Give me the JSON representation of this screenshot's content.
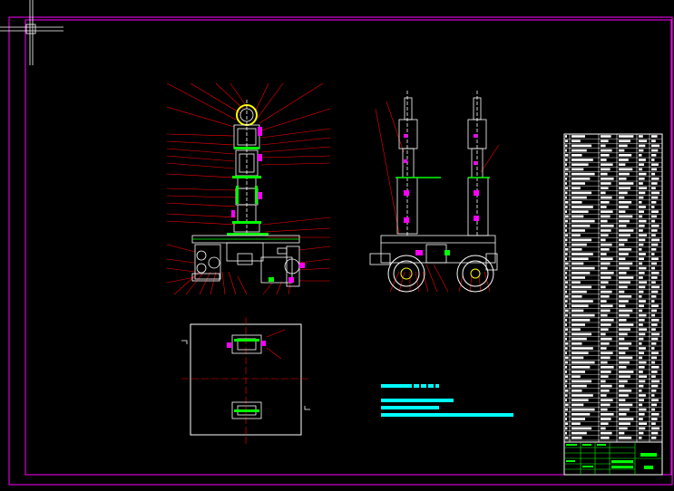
{
  "app": {
    "title": "",
    "view": "model-space"
  },
  "colors": {
    "background": "#000000",
    "frame": "#ff00ff",
    "leader": "#ff0000",
    "part": "#ffffff",
    "accent_green": "#00ff00",
    "accent_yellow": "#ffff00",
    "accent_cyan": "#00ffff",
    "accent_magenta": "#ff00ff"
  },
  "drawing": {
    "front_view_name": "front-view",
    "side_view_name": "side-view",
    "plan_view_name": "plan-view",
    "bom_table_name": "bill-of-materials",
    "title_block_name": "title-block",
    "technical_notes_name": "technical-requirements"
  },
  "icons": {
    "ucs": "ucs-crosshair-icon"
  }
}
